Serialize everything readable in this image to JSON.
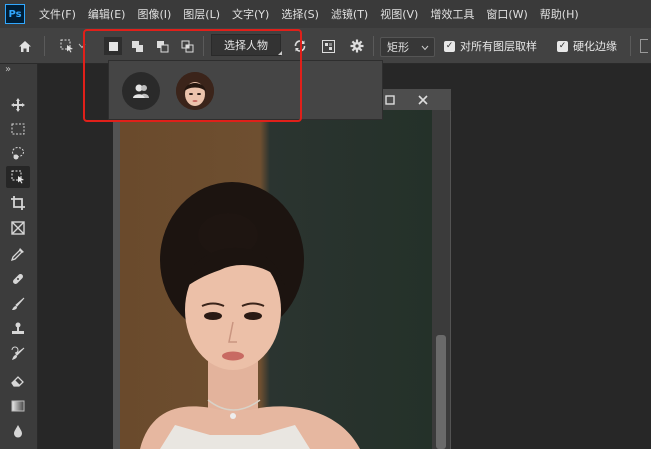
{
  "app": {
    "logo": "Ps"
  },
  "menu": [
    "文件(F)",
    "编辑(E)",
    "图像(I)",
    "图层(L)",
    "文字(Y)",
    "选择(S)",
    "滤镜(T)",
    "视图(V)",
    "增效工具",
    "窗口(W)",
    "帮助(H)"
  ],
  "options": {
    "select_subject_label": "选择人物",
    "mode_select": "矩形",
    "sample_all_layers_label": "对所有图层取样",
    "hard_edge_label": "硬化边缘",
    "sample_all_layers_checked": true,
    "hard_edge_checked": true
  },
  "toolbar": {
    "expand_label": "»",
    "tools": [
      "move",
      "marquee",
      "lasso",
      "object-selection",
      "crop",
      "frame",
      "eyedropper",
      "healing",
      "brush",
      "stamp",
      "history-brush",
      "eraser",
      "gradient",
      "blur"
    ],
    "active_tool": "object-selection"
  },
  "document": {
    "window_buttons": [
      "minimize",
      "close"
    ]
  },
  "popup": {
    "options": [
      "generic-person",
      "person-thumbnail"
    ]
  },
  "colors": {
    "highlight": "#e0201a",
    "accent": "#31a8ff"
  }
}
